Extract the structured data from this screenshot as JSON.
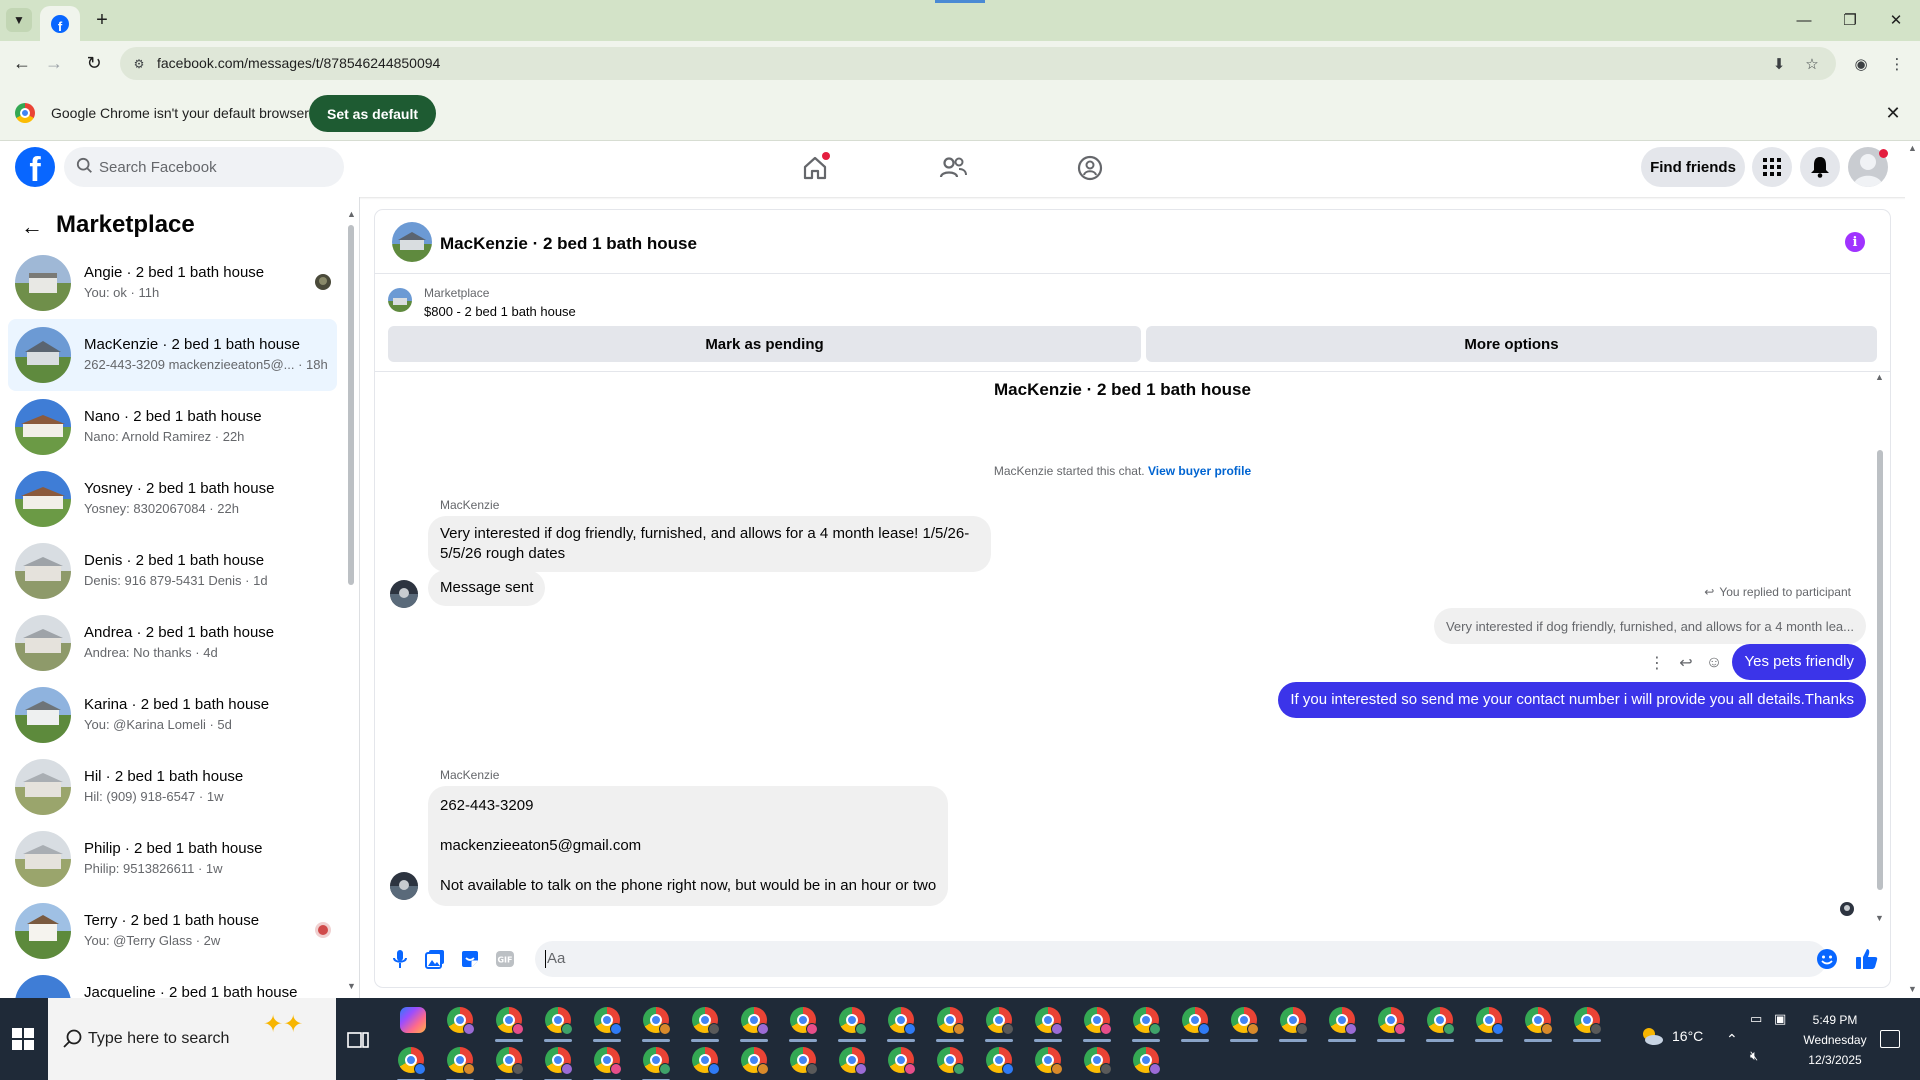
{
  "browser": {
    "url": "facebook.com/messages/t/878546244850094",
    "infobar_text": "Google Chrome isn't your default browser",
    "set_default_label": "Set as default"
  },
  "fb": {
    "search_placeholder": "Search Facebook",
    "find_friends_label": "Find friends"
  },
  "sidebar": {
    "title": "Marketplace",
    "items": [
      {
        "name": "Angie · 2 bed 1 bath house",
        "preview": "You: ok · 11h"
      },
      {
        "name": "MacKenzie · 2 bed 1 bath house",
        "preview": "262-443-3209 mackenzieeaton5@... · 18h"
      },
      {
        "name": "Nano · 2 bed 1 bath house",
        "preview": "Nano: Arnold Ramirez · 22h"
      },
      {
        "name": "Yosney · 2 bed 1 bath house",
        "preview": "Yosney: 8302067084 · 22h"
      },
      {
        "name": "Denis · 2 bed 1 bath house",
        "preview": "Denis: 916 879-5431 Denis · 1d"
      },
      {
        "name": "Andrea · 2 bed 1 bath house",
        "preview": "Andrea: No thanks · 4d"
      },
      {
        "name": "Karina · 2 bed 1 bath house",
        "preview": "You: @Karina Lomeli · 5d"
      },
      {
        "name": "Hil · 2 bed 1 bath house",
        "preview": "Hil: (909) 918-6547 · 1w"
      },
      {
        "name": "Philip · 2 bed 1 bath house",
        "preview": "Philip: 9513826611 · 1w"
      },
      {
        "name": "Terry · 2 bed 1 bath house",
        "preview": "You: @Terry Glass · 2w"
      },
      {
        "name": "Jacqueline · 2 bed 1 bath house",
        "preview": ""
      }
    ]
  },
  "chat": {
    "title": "MacKenzie · 2 bed 1 bath house",
    "listing_category": "Marketplace",
    "listing_price_title": "$800 - 2 bed 1 bath house",
    "mark_pending_label": "Mark as pending",
    "more_options_label": "More options",
    "conversation_title": "MacKenzie · 2 bed 1 bath house",
    "started_text": "MacKenzie started this chat.",
    "view_buyer_profile": "View buyer profile",
    "sender_name": "MacKenzie",
    "msg1": "Very interested if dog friendly, furnished, and allows for a 4 month lease! 1/5/26-5/5/26 rough dates",
    "msg2": "Message sent",
    "replied_label": "You replied to participant",
    "quoted_text": "Very interested if dog friendly, furnished, and allows for a 4 month lea...",
    "reply1": "Yes pets friendly",
    "reply2": "If you interested so send me your contact number i will provide you all details.Thanks",
    "msg3_phone": "262-443-3209",
    "msg3_email": "mackenzieeaton5@gmail.com",
    "msg3_note": "Not available to talk on the phone right now, but would be in an hour or two",
    "composer_placeholder": "Aa"
  },
  "taskbar": {
    "search_placeholder": "Type here to search",
    "temperature": "16°C",
    "time": "5:49 PM",
    "day": "Wednesday",
    "date": "12/3/2025"
  },
  "colors": {
    "accent_blue": "#0866ff",
    "outgoing_bubble": "#3b34e9",
    "incoming_bubble": "#f0f0f0",
    "active_item_bg": "#ebf5ff"
  }
}
